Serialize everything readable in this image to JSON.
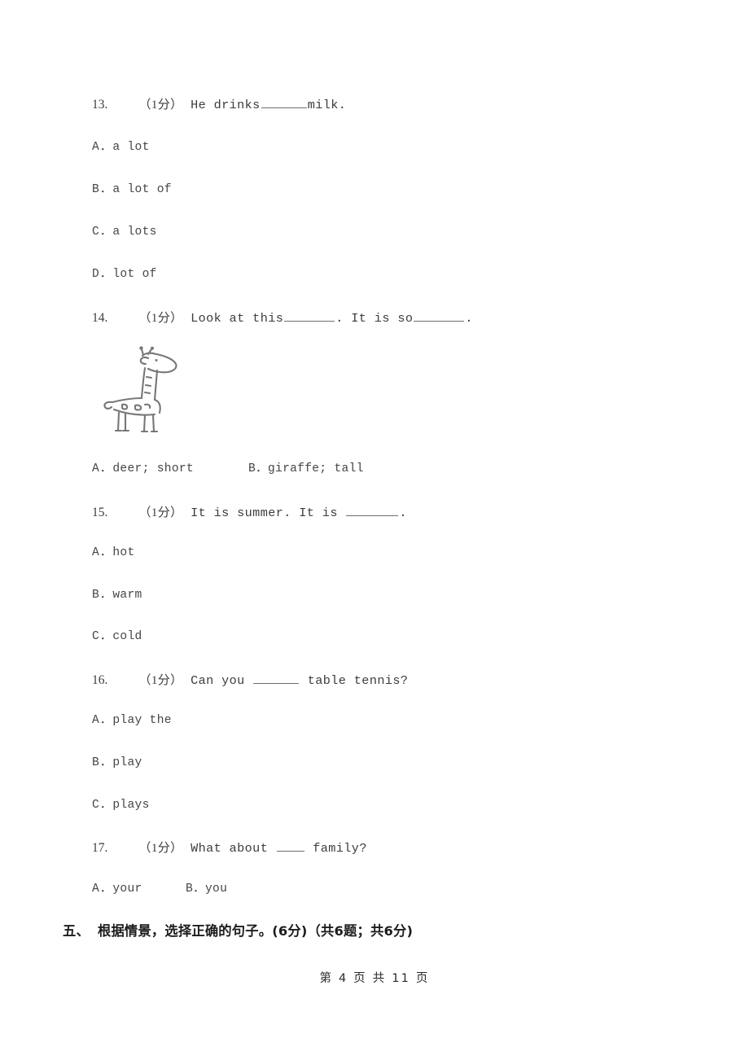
{
  "page": {
    "background_color": "#ffffff",
    "text_color": "#3a3a3a"
  },
  "questions": [
    {
      "number": "13.",
      "mark": "（1分）",
      "stem_part_1": "He drinks",
      "stem_part_2": "milk.",
      "options": [
        {
          "label": "A．",
          "text": "a lot"
        },
        {
          "label": "B．",
          "text": "a lot of"
        },
        {
          "label": "C．",
          "text": "a lots"
        },
        {
          "label": "D．",
          "text": "lot of"
        }
      ]
    },
    {
      "number": "14.",
      "mark": "（1分）",
      "stem_part_1": "Look at this",
      "stem_part_2": ". It is so",
      "stem_part_3": ".",
      "figure": "giraffe-line-drawing",
      "options": [
        {
          "label": "A．",
          "text": "deer; short"
        },
        {
          "label": "B．",
          "text": "giraffe; tall"
        }
      ]
    },
    {
      "number": "15.",
      "mark": "（1分）",
      "stem_part_1": "It is summer. It is ",
      "stem_part_2": ".",
      "options": [
        {
          "label": "A．",
          "text": "hot"
        },
        {
          "label": "B．",
          "text": "warm"
        },
        {
          "label": "C．",
          "text": "cold"
        }
      ]
    },
    {
      "number": "16.",
      "mark": "（1分）",
      "stem_part_1": "Can you ",
      "stem_part_2": " table tennis?",
      "options": [
        {
          "label": "A．",
          "text": "play the"
        },
        {
          "label": "B．",
          "text": "play"
        },
        {
          "label": "C．",
          "text": "plays"
        }
      ]
    },
    {
      "number": "17.",
      "mark": "（1分）",
      "stem_part_1": "What about ",
      "stem_part_2": " family?",
      "options": [
        {
          "label": "A．",
          "text": "your"
        },
        {
          "label": "B．",
          "text": "you"
        }
      ]
    }
  ],
  "section_heading": {
    "index": "五、",
    "text": "根据情景，选择正确的句子。(6分)（共6题；共6分)"
  },
  "footer": {
    "text": "第 4 页 共 11 页"
  }
}
